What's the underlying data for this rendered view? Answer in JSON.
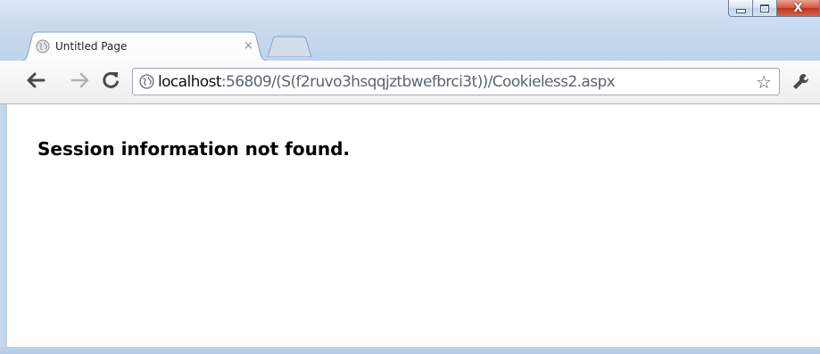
{
  "window": {
    "caption_buttons": {
      "minimize_icon": "minimize-icon",
      "maximize_icon": "maximize-icon",
      "close_glyph": "X"
    },
    "frame_color": "#bcd2ea",
    "close_color": "#c9422a"
  },
  "tabs": [
    {
      "title": "Untitled Page",
      "icon": "globe-icon",
      "close_glyph": "×",
      "active": true
    }
  ],
  "toolbar": {
    "back_icon": "back-arrow-icon",
    "forward_icon": "forward-arrow-icon",
    "reload_icon": "reload-icon",
    "omnibox": {
      "site_icon": "globe-icon",
      "host": "localhost",
      "rest": ":56809/(S(f2ruvo3hsqqjztbwefbrci3t))/Cookieless2.aspx"
    },
    "bookmark_icon": "star-icon",
    "menu_icon": "wrench-icon"
  },
  "page": {
    "message": "Session information not found."
  }
}
